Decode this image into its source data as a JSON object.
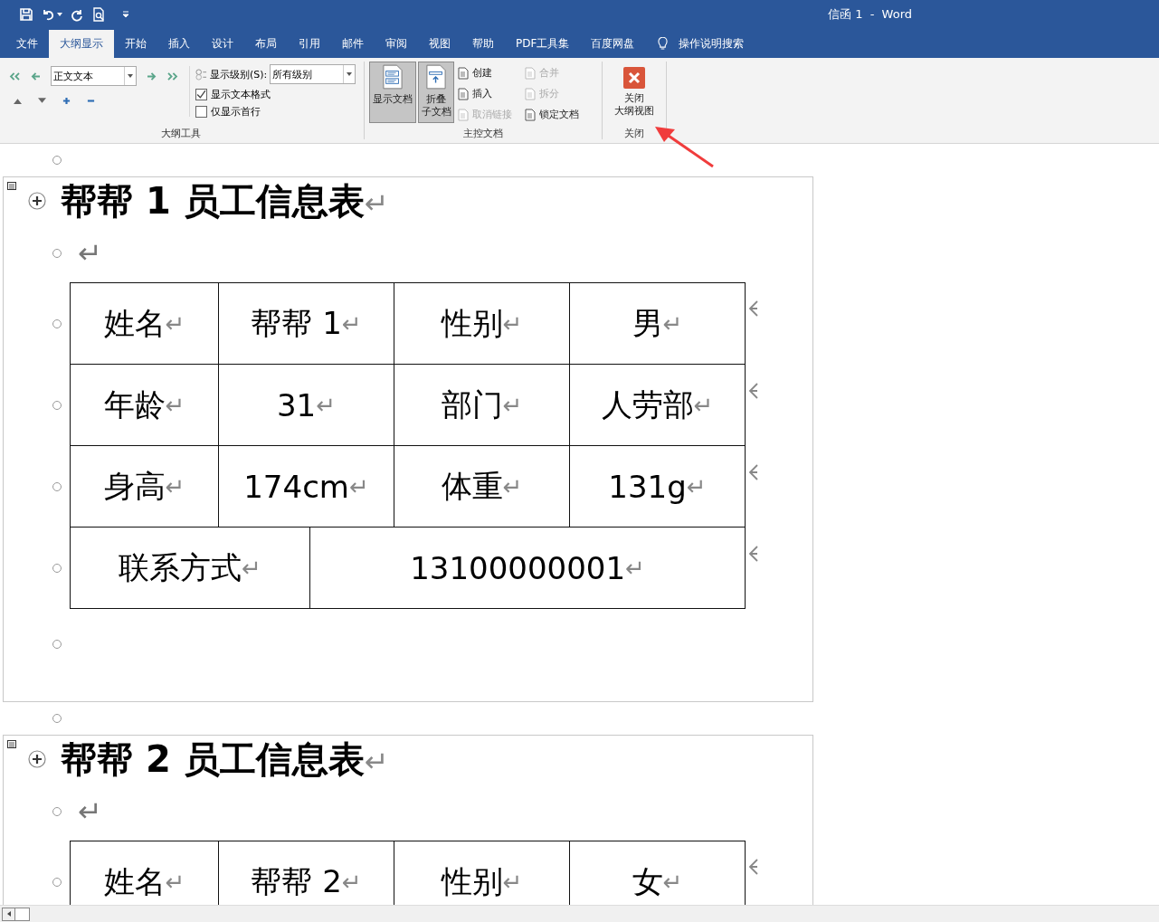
{
  "window": {
    "title": "信函 1  -  Word"
  },
  "tabs": [
    {
      "label": "文件",
      "selected": false
    },
    {
      "label": "大纲显示",
      "selected": true
    },
    {
      "label": "开始",
      "selected": false
    },
    {
      "label": "插入",
      "selected": false
    },
    {
      "label": "设计",
      "selected": false
    },
    {
      "label": "布局",
      "selected": false
    },
    {
      "label": "引用",
      "selected": false
    },
    {
      "label": "邮件",
      "selected": false
    },
    {
      "label": "审阅",
      "selected": false
    },
    {
      "label": "视图",
      "selected": false
    },
    {
      "label": "帮助",
      "selected": false
    },
    {
      "label": "PDF工具集",
      "selected": false
    },
    {
      "label": "百度网盘",
      "selected": false
    }
  ],
  "tell_me": {
    "placeholder": "操作说明搜索"
  },
  "ribbon": {
    "outline_tools": {
      "level_value": "正文文本",
      "show_level_label": "显示级别(S):",
      "show_level_value": "所有级别",
      "checkboxes": [
        {
          "label": "显示文本格式",
          "checked": true
        },
        {
          "label": "仅显示首行",
          "checked": false
        }
      ],
      "group_label": "大纲工具"
    },
    "master_document": {
      "large_buttons": [
        {
          "lines": [
            "显示文档"
          ],
          "selected": true
        },
        {
          "lines": [
            "折叠",
            "子文档"
          ],
          "selected": true
        }
      ],
      "small_buttons": [
        {
          "label": "创建",
          "disabled": false
        },
        {
          "label": "插入",
          "disabled": false
        },
        {
          "label": "取消链接",
          "disabled": true
        },
        {
          "label": "合并",
          "disabled": true
        },
        {
          "label": "拆分",
          "disabled": true
        },
        {
          "label": "锁定文档",
          "disabled": false
        }
      ],
      "group_label": "主控文档"
    },
    "close": {
      "lines": [
        "关闭",
        "大纲视图"
      ],
      "group_label": "关闭"
    }
  },
  "document": {
    "sections": [
      {
        "title": "帮帮 1 员工信息表",
        "title_mark": "↵",
        "empty_mark": "↵",
        "rows": [
          [
            {
              "text": "姓名",
              "mark": "↵"
            },
            {
              "text": "帮帮 1",
              "mark": "↵"
            },
            {
              "text": "性别",
              "mark": "↵"
            },
            {
              "text": "男",
              "mark": "↵"
            }
          ],
          [
            {
              "text": "年龄",
              "mark": "↵"
            },
            {
              "text": "31",
              "mark": "↵"
            },
            {
              "text": "部门",
              "mark": "↵"
            },
            {
              "text": "人劳部",
              "mark": "↵"
            }
          ],
          [
            {
              "text": "身高",
              "mark": "↵"
            },
            {
              "text": "174cm",
              "mark": "↵"
            },
            {
              "text": "体重",
              "mark": "↵"
            },
            {
              "text": "131g",
              "mark": "↵"
            }
          ]
        ],
        "contact_row": {
          "label": {
            "text": "联系方式",
            "mark": "↵"
          },
          "value": {
            "text": "13100000001",
            "mark": "↵"
          }
        }
      },
      {
        "title": "帮帮 2 员工信息表",
        "title_mark": "↵",
        "empty_mark": "↵",
        "rows": [
          [
            {
              "text": "姓名",
              "mark": "↵"
            },
            {
              "text": "帮帮 2",
              "mark": "↵"
            },
            {
              "text": "性别",
              "mark": "↵"
            },
            {
              "text": "女",
              "mark": "↵"
            }
          ]
        ]
      }
    ]
  }
}
